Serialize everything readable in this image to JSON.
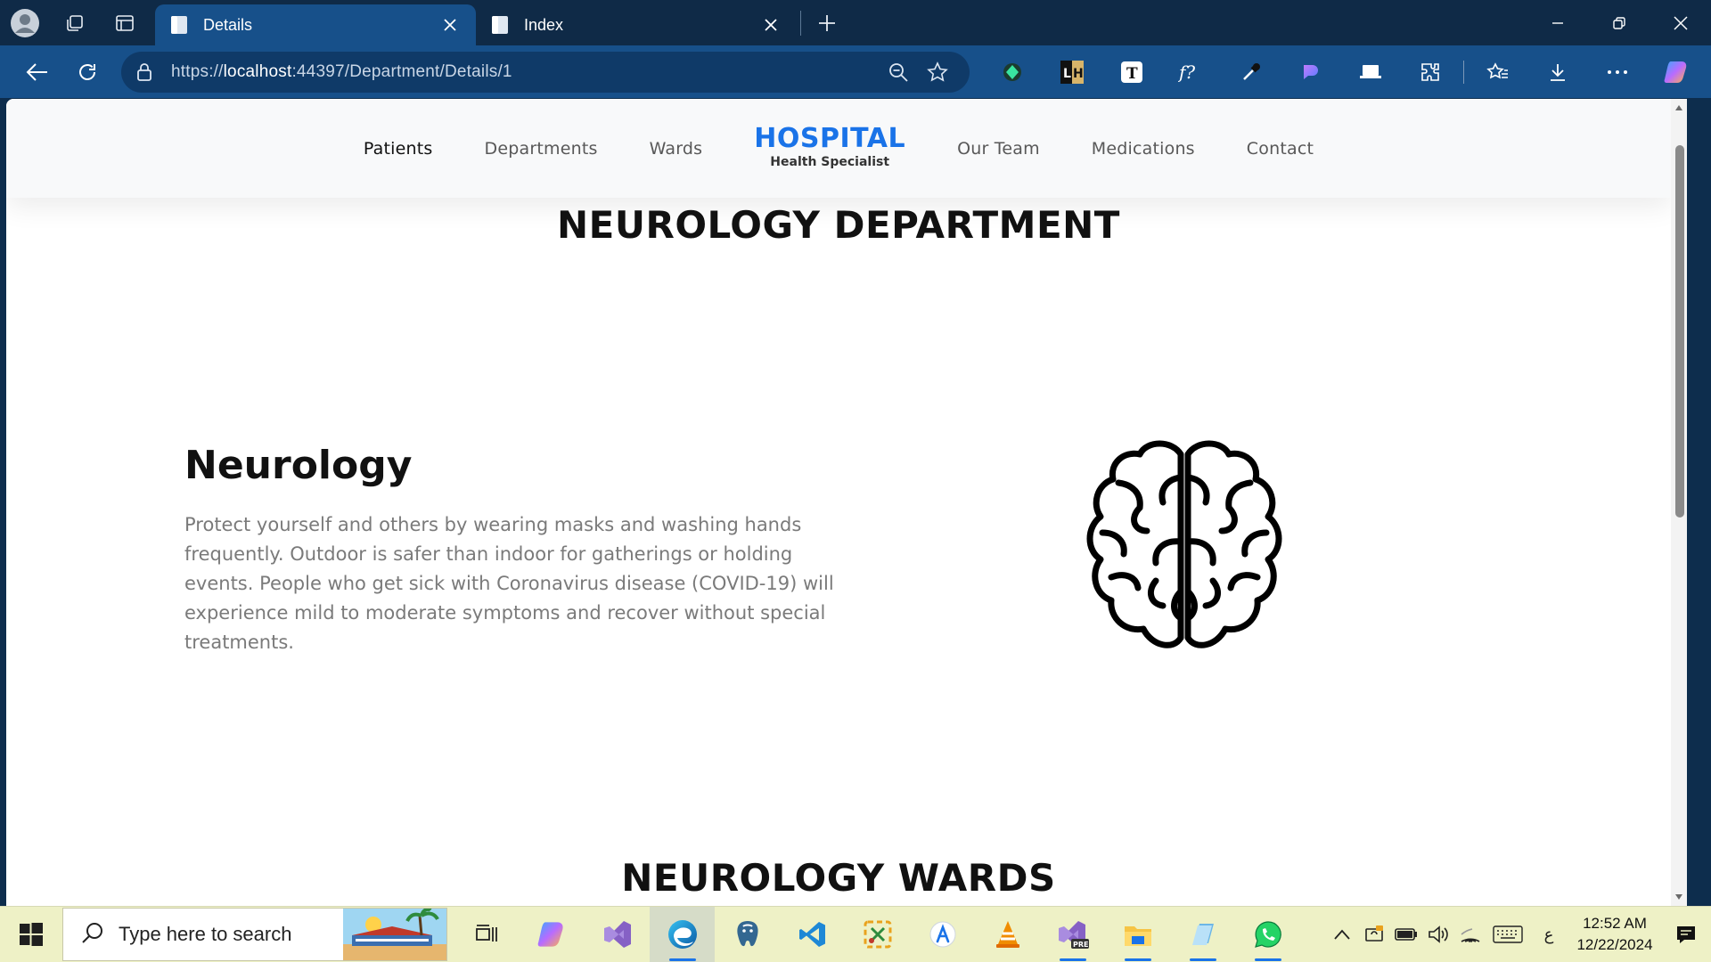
{
  "browser": {
    "tabs": [
      {
        "label": "Details",
        "active": true
      },
      {
        "label": "Index",
        "active": false
      }
    ],
    "url": {
      "scheme": "https://",
      "host": "localhost",
      "rest": ":44397/Department/Details/1"
    }
  },
  "site": {
    "nav_left": [
      "Patients",
      "Departments",
      "Wards"
    ],
    "brand": {
      "title": "HOSPITAL",
      "subtitle": "Health Specialist"
    },
    "nav_right": [
      "Our Team",
      "Medications",
      "Contact"
    ],
    "active_nav": "Patients",
    "accent_color": "#1a73e8"
  },
  "page": {
    "title": "NEUROLOGY DEPARTMENT",
    "department_name": "Neurology",
    "description": "Protect yourself and others by wearing masks and washing hands frequently. Outdoor is safer than indoor for gatherings or holding events. People who get sick with Coronavirus disease (COVID-19) will experience mild to moderate symptoms and recover without special treatments.",
    "illustration_icon": "brain-icon",
    "wards_title": "NEUROLOGY WARDS"
  },
  "taskbar": {
    "search_placeholder": "Type here to search",
    "time": "12:52 AM",
    "date": "12/22/2024",
    "ime_indicator": "ع"
  }
}
